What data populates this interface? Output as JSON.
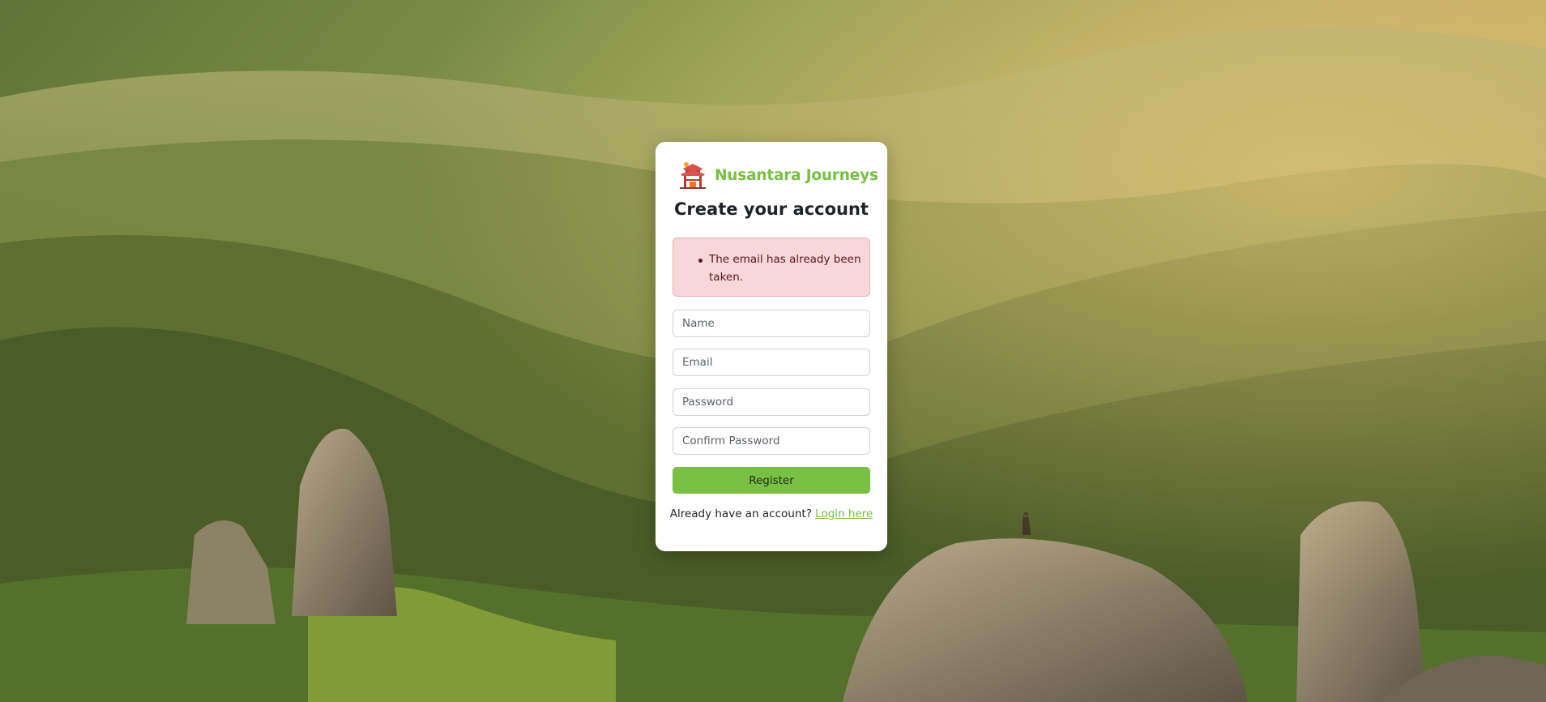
{
  "brand": {
    "name": "Nusantara Journeys",
    "logo_icon": "temple-gate-icon",
    "color": "#77c043"
  },
  "page": {
    "title": "Create your account"
  },
  "alert": {
    "errors": [
      "The email has already been taken."
    ],
    "background": "#f8d7da",
    "text_color": "#58151c"
  },
  "form": {
    "name_placeholder": "Name",
    "email_placeholder": "Email",
    "password_placeholder": "Password",
    "confirm_password_placeholder": "Confirm Password",
    "submit_label": "Register",
    "submit_color": "#77c043"
  },
  "footer": {
    "prompt": "Already have an account?",
    "login_link": "Login here"
  }
}
